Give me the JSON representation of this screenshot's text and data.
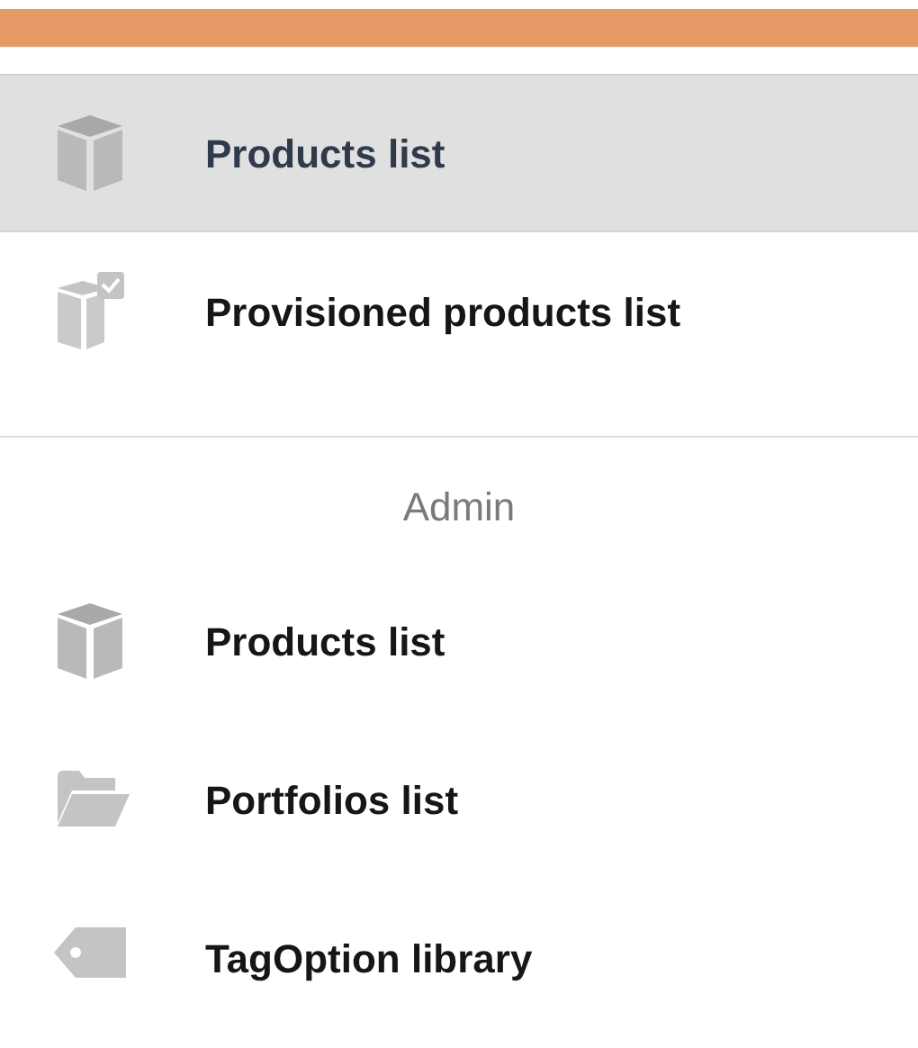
{
  "sections": [
    {
      "items": [
        {
          "label": "Products list",
          "kind": "cube",
          "selected": true
        },
        {
          "label": "Provisioned products list",
          "kind": "cube-check",
          "selected": false
        }
      ]
    },
    {
      "heading": "Admin",
      "items": [
        {
          "label": "Products list",
          "kind": "cube",
          "selected": false
        },
        {
          "label": "Portfolios list",
          "kind": "folder",
          "selected": false
        },
        {
          "label": "TagOption library",
          "kind": "tag",
          "selected": false
        }
      ]
    }
  ]
}
